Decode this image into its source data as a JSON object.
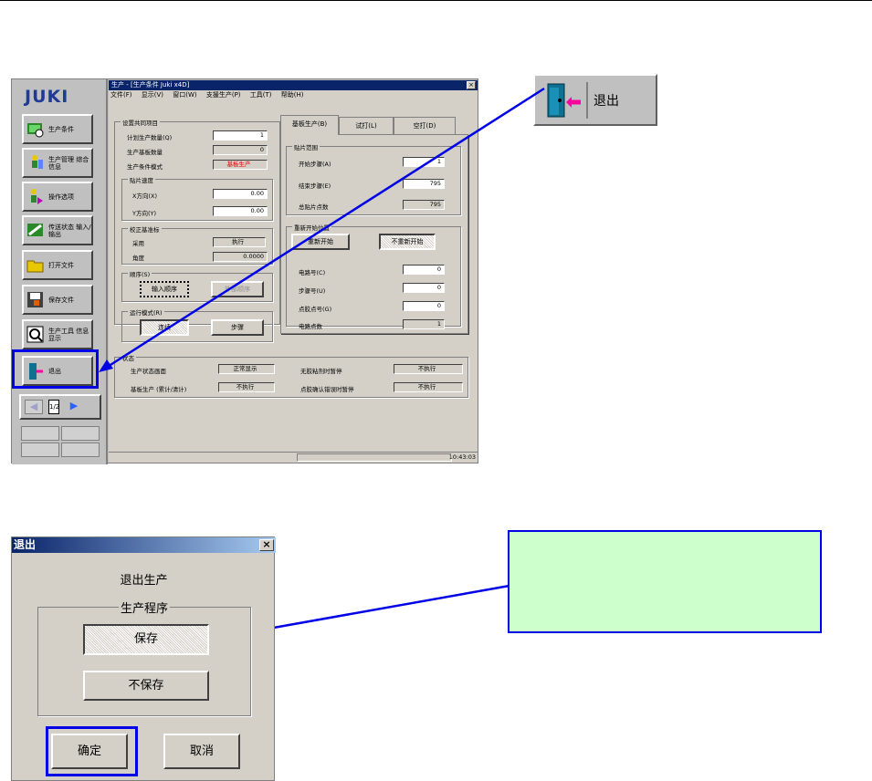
{
  "main_window": {
    "title": "生产 - [生产条件 Juki x4D]",
    "menu": [
      "文件(F)",
      "显示(V)",
      "窗口(W)",
      "支援生产(P)",
      "工具(T)",
      "帮助(H)"
    ],
    "close_glyph": "×",
    "clock": "10:43:03"
  },
  "sidebar": {
    "logo": "JUKI",
    "buttons": [
      "生产条件",
      "生产管理 综合信息",
      "操作选项",
      "传送状态 输入/输出",
      "打开文件",
      "保存文件",
      "生产工具 信息显示",
      "退出"
    ],
    "page_indicator": "1/2"
  },
  "common": {
    "caption": "设置共同项目",
    "plan_label": "计划生产数量(Q)",
    "plan_value": "1",
    "produced_label": "生产基板数量",
    "produced_value": "0",
    "mode_label": "生产条件模式",
    "mode_value": "基板生产"
  },
  "speed": {
    "caption": "贴片速度",
    "x_label": "X方向(X)",
    "x_value": "0.00",
    "y_label": "Y方向(Y)",
    "y_value": "0.00"
  },
  "calib": {
    "caption": "校正基准标",
    "adopt_label": "采用",
    "adopt_value": "执行",
    "angle_label": "角度",
    "angle_value": "0.0000"
  },
  "order": {
    "caption": "顺序(S)",
    "input_btn": "输入顺序",
    "ext_btn": "外部顺序"
  },
  "run": {
    "caption": "运行模式(R)",
    "cont_btn": "连续",
    "step_btn": "步骤"
  },
  "tabs": [
    "基板生产(B)",
    "试打(L)",
    "空打(D)"
  ],
  "range": {
    "caption": "贴片范围",
    "start_label": "开始步骤(A)",
    "start_value": "1",
    "end_label": "结束步骤(E)",
    "end_value": "795",
    "total_label": "总贴片点数",
    "total_value": "795"
  },
  "restart": {
    "caption": "重新开始位置",
    "restart_btn": "重新开始",
    "norestart_btn": "不重新开始",
    "circuit_label": "电路号(C)",
    "circuit_value": "0",
    "step_label": "步骤号(U)",
    "step_value": "0",
    "glue_label": "点胶点号(G)",
    "glue_value": "0",
    "circuit_count_label": "电路点数",
    "circuit_count_value": "1"
  },
  "status": {
    "caption": "状态",
    "screen_label": "生产状态画面",
    "screen_value": "正常显示",
    "board_label": "基板生产 (累计/清计)",
    "board_value": "不执行",
    "noglue_label": "无胶粘剂时暂停",
    "noglue_value": "不执行",
    "confirm_label": "点胶确认错误时暂停",
    "confirm_value": "不执行"
  },
  "exit_zoom": {
    "label": "退出"
  },
  "dialog": {
    "title": "退出",
    "close_glyph": "×",
    "heading": "退出生产",
    "group_caption": "生产程序",
    "save_btn": "保存",
    "nosave_btn": "不保存",
    "ok_btn": "确定",
    "cancel_btn": "取消"
  },
  "colors": {
    "highlight": "#0000e6",
    "note_fill": "#ccffcc",
    "titlebar": "#0a246a",
    "juki_blue": "#1e3c96",
    "red_value": "#e00000"
  }
}
